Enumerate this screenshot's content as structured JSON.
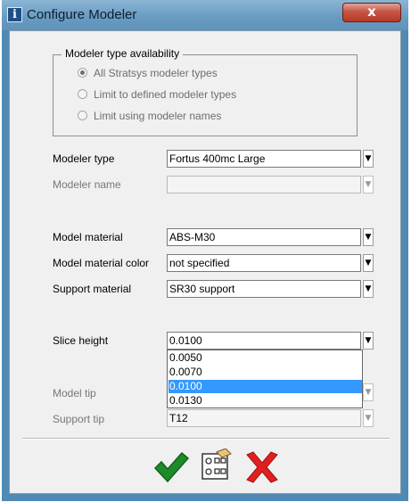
{
  "window": {
    "title": "Configure Modeler",
    "close_label": "x",
    "icon_letter": "i"
  },
  "availability": {
    "legend": "Modeler type availability",
    "options": [
      {
        "label": "All Stratsys modeler types",
        "selected": true
      },
      {
        "label": "Limit to defined modeler types",
        "selected": false
      },
      {
        "label": "Limit using modeler names",
        "selected": false
      }
    ]
  },
  "fields": {
    "modeler_type": {
      "label": "Modeler type",
      "value": "Fortus 400mc Large"
    },
    "modeler_name": {
      "label": "Modeler name",
      "value": ""
    },
    "model_material": {
      "label": "Model material",
      "value": "ABS-M30"
    },
    "model_material_color": {
      "label": "Model material color",
      "value": "not specified"
    },
    "support_material": {
      "label": "Support material",
      "value": "SR30 support"
    },
    "slice_height": {
      "label": "Slice height",
      "value": "0.0100"
    },
    "model_tip": {
      "label": "Model tip",
      "value": ""
    },
    "support_tip": {
      "label": "Support tip",
      "value": "T12"
    }
  },
  "slice_height_options": [
    "0.0050",
    "0.0070",
    "0.0100",
    "0.0130"
  ],
  "slice_height_selected_index": 2,
  "buttons": {
    "ok_icon": "green-check-icon",
    "settings_icon": "settings-grid-icon",
    "cancel_icon": "red-x-icon"
  },
  "colors": {
    "titlebar": "#6a9cc2",
    "close": "#c85544",
    "selection": "#3399ff",
    "ok": "#1e8a2a",
    "cancel": "#e02020"
  }
}
